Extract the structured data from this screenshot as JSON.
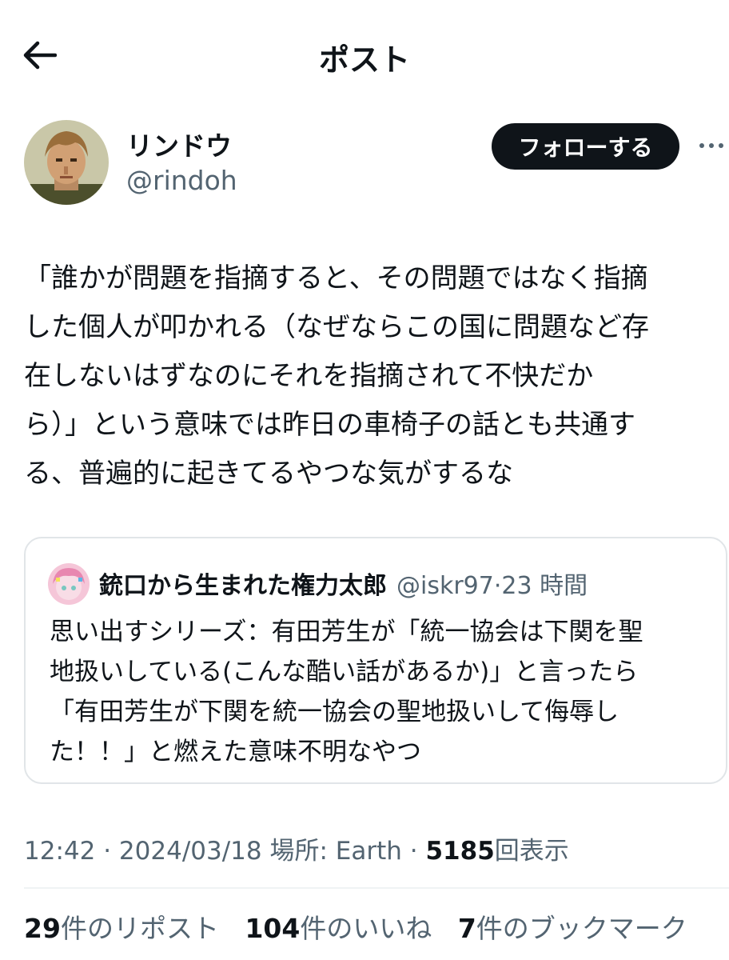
{
  "header": {
    "back_icon": "arrow-left-icon",
    "title": "ポスト"
  },
  "author": {
    "name": "リンドウ",
    "handle": "@rindoh",
    "follow_label": "フォローする",
    "more_icon": "more-horizontal-icon"
  },
  "tweet": {
    "text": "「誰かが問題を指摘すると、その問題ではなく指摘\nした個人が叩かれる（なぜならこの国に問題など存\n在しないはずなのにそれを指摘されて不快だか\nら）」という意味では昨日の車椅子の話とも共通す\nる、普遍的に起きてるやつな気がするな"
  },
  "quote": {
    "name": "銃口から生まれた権力太郎",
    "handle": "@iskr97",
    "separator": "·",
    "time": "23 時間",
    "text": "思い出すシリーズ：有田芳生が「統一協会は下関を聖\n地扱いしている(こんな酷い話があるか)」と言ったら\n「有田芳生が下関を統一協会の聖地扱いして侮辱し\nた！！」と燃えた意味不明なやつ"
  },
  "meta": {
    "time": "12:42",
    "sep1": "·",
    "date": "2024/03/18",
    "location": "場所: Earth",
    "sep2": "·",
    "views_count": "5185",
    "views_label": "回表示"
  },
  "stats": {
    "reposts_count": "29",
    "reposts_label": "件のリポスト",
    "likes_count": "104",
    "likes_label": "件のいいね",
    "bookmarks_count": "7",
    "bookmarks_label": "件のブックマーク"
  },
  "colors": {
    "text": "#0f1419",
    "secondary": "#536471",
    "border": "#e1e5e8",
    "follow_bg": "#0f1419"
  }
}
